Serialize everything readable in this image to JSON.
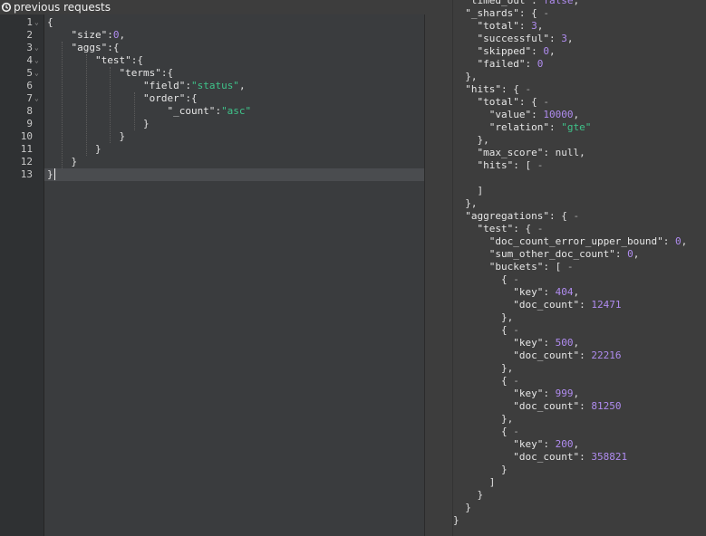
{
  "toolbar": {
    "history_label": "previous requests"
  },
  "colors": {
    "key": "#e6e6e6",
    "string": "#3fc38a",
    "number": "#b08cf0",
    "editor_bg": "#3a3c3e",
    "gutter_bg": "#2f3133"
  },
  "editor": {
    "line_numbers": [
      "1",
      "2",
      "3",
      "4",
      "5",
      "6",
      "7",
      "8",
      "9",
      "10",
      "11",
      "12",
      "13"
    ],
    "fold_lines": [
      1,
      3,
      4,
      5,
      7
    ],
    "active_line": 13,
    "lines": [
      [
        [
          "p",
          "{"
        ]
      ],
      [
        [
          "k",
          "    \"size\""
        ],
        [
          "p",
          ":"
        ],
        [
          "n",
          "0"
        ],
        [
          "p",
          ","
        ]
      ],
      [
        [
          "k",
          "    \"aggs\""
        ],
        [
          "p",
          ":{"
        ]
      ],
      [
        [
          "k",
          "        \"test\""
        ],
        [
          "p",
          ":{"
        ]
      ],
      [
        [
          "k",
          "            \"terms\""
        ],
        [
          "p",
          ":{"
        ]
      ],
      [
        [
          "k",
          "                \"field\""
        ],
        [
          "p",
          ":"
        ],
        [
          "s",
          "\"status\""
        ],
        [
          "p",
          ","
        ]
      ],
      [
        [
          "k",
          "                \"order\""
        ],
        [
          "p",
          ":{"
        ]
      ],
      [
        [
          "k",
          "                    \"_count\""
        ],
        [
          "p",
          ":"
        ],
        [
          "s",
          "\"asc\""
        ]
      ],
      [
        [
          "p",
          "                }"
        ]
      ],
      [
        [
          "p",
          "            }"
        ]
      ],
      [
        [
          "p",
          "        }"
        ]
      ],
      [
        [
          "p",
          "    }"
        ]
      ],
      [
        [
          "p",
          "}"
        ]
      ]
    ]
  },
  "response": {
    "lines": [
      [
        [
          "k",
          "  \"timed_out\""
        ],
        [
          "p",
          ": "
        ],
        [
          "n",
          "false"
        ],
        [
          "p",
          ","
        ]
      ],
      [
        [
          "k",
          "  \"_shards\""
        ],
        [
          "p",
          ": { "
        ],
        [
          "fd",
          "-"
        ]
      ],
      [
        [
          "k",
          "    \"total\""
        ],
        [
          "p",
          ": "
        ],
        [
          "n",
          "3"
        ],
        [
          "p",
          ","
        ]
      ],
      [
        [
          "k",
          "    \"successful\""
        ],
        [
          "p",
          ": "
        ],
        [
          "n",
          "3"
        ],
        [
          "p",
          ","
        ]
      ],
      [
        [
          "k",
          "    \"skipped\""
        ],
        [
          "p",
          ": "
        ],
        [
          "n",
          "0"
        ],
        [
          "p",
          ","
        ]
      ],
      [
        [
          "k",
          "    \"failed\""
        ],
        [
          "p",
          ": "
        ],
        [
          "n",
          "0"
        ]
      ],
      [
        [
          "p",
          "  },"
        ]
      ],
      [
        [
          "k",
          "  \"hits\""
        ],
        [
          "p",
          ": { "
        ],
        [
          "fd",
          "-"
        ]
      ],
      [
        [
          "k",
          "    \"total\""
        ],
        [
          "p",
          ": { "
        ],
        [
          "fd",
          "-"
        ]
      ],
      [
        [
          "k",
          "      \"value\""
        ],
        [
          "p",
          ": "
        ],
        [
          "n",
          "10000"
        ],
        [
          "p",
          ","
        ]
      ],
      [
        [
          "k",
          "      \"relation\""
        ],
        [
          "p",
          ": "
        ],
        [
          "s",
          "\"gte\""
        ]
      ],
      [
        [
          "p",
          "    },"
        ]
      ],
      [
        [
          "k",
          "    \"max_score\""
        ],
        [
          "p",
          ": null,"
        ]
      ],
      [
        [
          "k",
          "    \"hits\""
        ],
        [
          "p",
          ": [ "
        ],
        [
          "fd",
          "-"
        ]
      ],
      [
        [
          "p",
          ""
        ]
      ],
      [
        [
          "p",
          "    ]"
        ]
      ],
      [
        [
          "p",
          "  },"
        ]
      ],
      [
        [
          "k",
          "  \"aggregations\""
        ],
        [
          "p",
          ": { "
        ],
        [
          "fd",
          "-"
        ]
      ],
      [
        [
          "k",
          "    \"test\""
        ],
        [
          "p",
          ": { "
        ],
        [
          "fd",
          "-"
        ]
      ],
      [
        [
          "k",
          "      \"doc_count_error_upper_bound\""
        ],
        [
          "p",
          ": "
        ],
        [
          "n",
          "0"
        ],
        [
          "p",
          ","
        ]
      ],
      [
        [
          "k",
          "      \"sum_other_doc_count\""
        ],
        [
          "p",
          ": "
        ],
        [
          "n",
          "0"
        ],
        [
          "p",
          ","
        ]
      ],
      [
        [
          "k",
          "      \"buckets\""
        ],
        [
          "p",
          ": [ "
        ],
        [
          "fd",
          "-"
        ]
      ],
      [
        [
          "p",
          "        { "
        ],
        [
          "fd",
          "-"
        ]
      ],
      [
        [
          "k",
          "          \"key\""
        ],
        [
          "p",
          ": "
        ],
        [
          "n",
          "404"
        ],
        [
          "p",
          ","
        ]
      ],
      [
        [
          "k",
          "          \"doc_count\""
        ],
        [
          "p",
          ": "
        ],
        [
          "n",
          "12471"
        ]
      ],
      [
        [
          "p",
          "        },"
        ]
      ],
      [
        [
          "p",
          "        { "
        ],
        [
          "fd",
          "-"
        ]
      ],
      [
        [
          "k",
          "          \"key\""
        ],
        [
          "p",
          ": "
        ],
        [
          "n",
          "500"
        ],
        [
          "p",
          ","
        ]
      ],
      [
        [
          "k",
          "          \"doc_count\""
        ],
        [
          "p",
          ": "
        ],
        [
          "n",
          "22216"
        ]
      ],
      [
        [
          "p",
          "        },"
        ]
      ],
      [
        [
          "p",
          "        { "
        ],
        [
          "fd",
          "-"
        ]
      ],
      [
        [
          "k",
          "          \"key\""
        ],
        [
          "p",
          ": "
        ],
        [
          "n",
          "999"
        ],
        [
          "p",
          ","
        ]
      ],
      [
        [
          "k",
          "          \"doc_count\""
        ],
        [
          "p",
          ": "
        ],
        [
          "n",
          "81250"
        ]
      ],
      [
        [
          "p",
          "        },"
        ]
      ],
      [
        [
          "p",
          "        { "
        ],
        [
          "fd",
          "-"
        ]
      ],
      [
        [
          "k",
          "          \"key\""
        ],
        [
          "p",
          ": "
        ],
        [
          "n",
          "200"
        ],
        [
          "p",
          ","
        ]
      ],
      [
        [
          "k",
          "          \"doc_count\""
        ],
        [
          "p",
          ": "
        ],
        [
          "n",
          "358821"
        ]
      ],
      [
        [
          "p",
          "        }"
        ]
      ],
      [
        [
          "p",
          "      ]"
        ]
      ],
      [
        [
          "p",
          "    }"
        ]
      ],
      [
        [
          "p",
          "  }"
        ]
      ],
      [
        [
          "p",
          "}"
        ]
      ]
    ]
  }
}
